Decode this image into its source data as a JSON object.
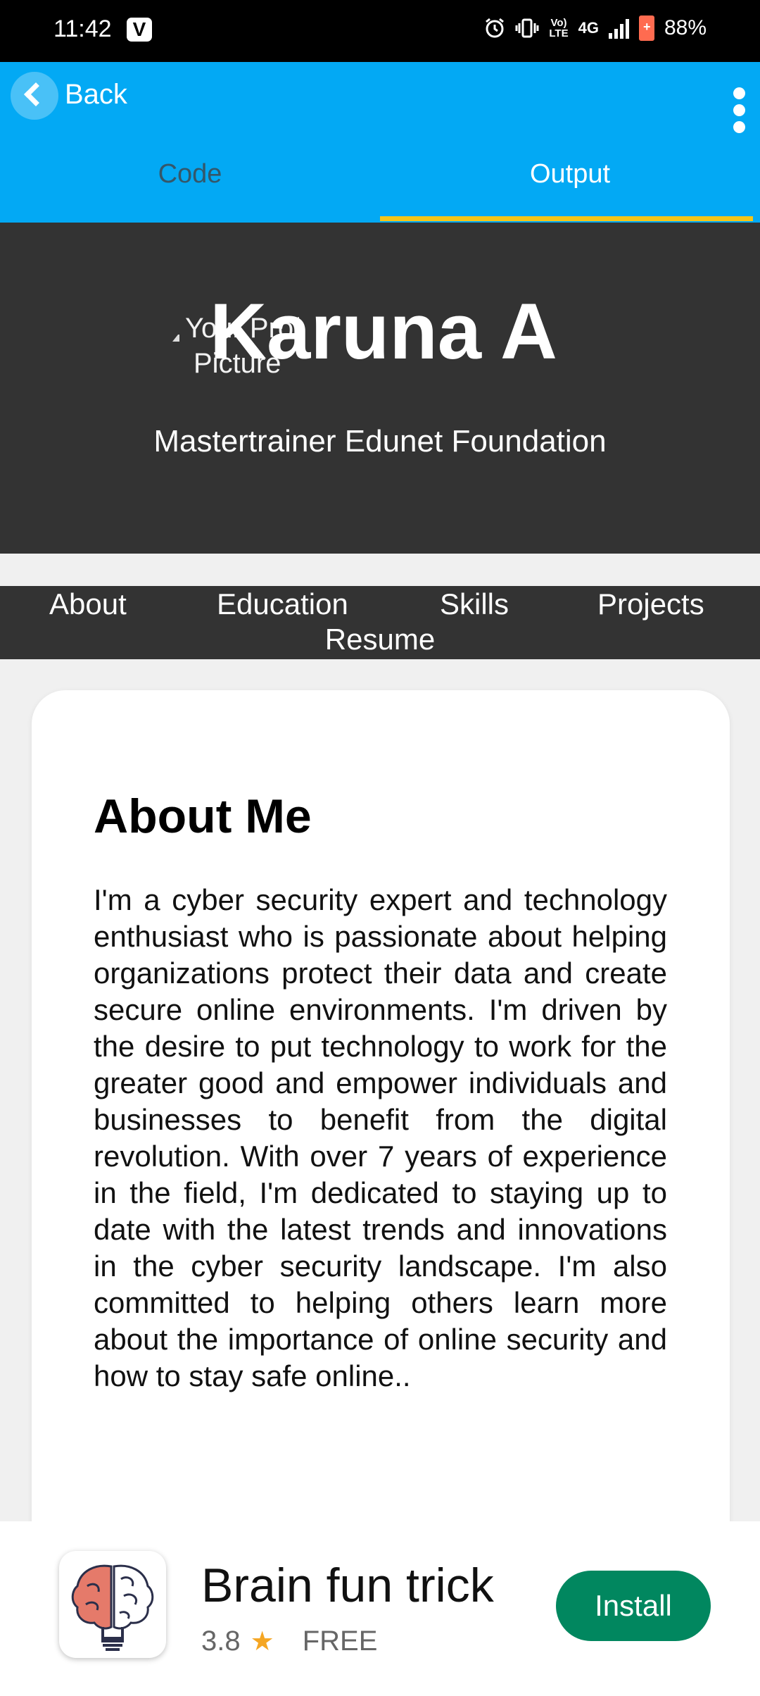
{
  "status_bar": {
    "time": "11:42",
    "app_badge": "V",
    "network_top": "Vo)",
    "network_bottom": "LTE",
    "network_type": "4G",
    "battery": "88%"
  },
  "app_bar": {
    "back_label": "Back",
    "tabs": [
      {
        "label": "Code",
        "selected": false
      },
      {
        "label": "Output",
        "selected": true
      }
    ],
    "accent_color": "#03a9f4",
    "indicator_color": "#f5c518"
  },
  "profile": {
    "picture_alt_line1": "Your Profile",
    "picture_alt_line2": "Picture",
    "name": "Karuna A",
    "role": "Mastertrainer Edunet Foundation"
  },
  "nav": {
    "about": "About",
    "education": "Education",
    "skills": "Skills",
    "projects": "Projects",
    "resume": "Resume"
  },
  "about": {
    "title": "About Me",
    "text": "I'm a cyber security expert and technology enthusiast who is passionate about helping organizations protect their data and create secure online environments. I'm driven by the desire to put technology to work for the greater good and empower individuals and businesses to benefit from the digital revolution. With over 7 years of experience in the field, I'm dedicated to staying up to date with the latest trends and innovations in the cyber security landscape. I'm also committed to helping others learn more about the importance of online security and how to stay safe online.."
  },
  "ad": {
    "app_name": "Brain fun trick",
    "rating": "3.8",
    "price": "FREE",
    "install_label": "Install",
    "install_color": "#01875f"
  }
}
